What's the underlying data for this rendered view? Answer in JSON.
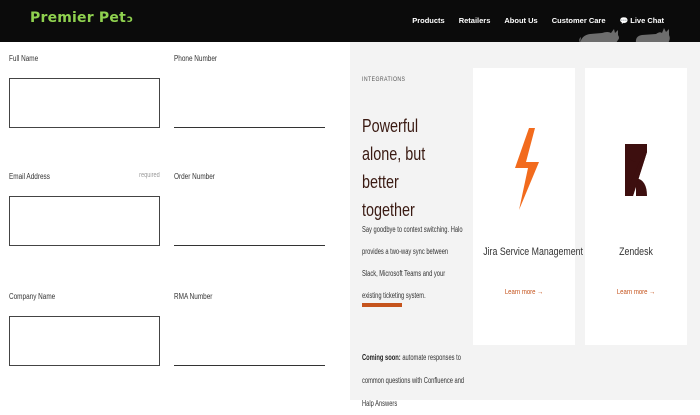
{
  "header": {
    "brand": "Premier Pet",
    "brand_mark": "⌠",
    "nav": [
      {
        "label": "Products"
      },
      {
        "label": "Retailers"
      },
      {
        "label": "About Us"
      },
      {
        "label": "Customer Care"
      },
      {
        "label": "Live Chat",
        "icon": "chat-bubbles-icon"
      }
    ]
  },
  "form": {
    "full_name_label": "Full Name",
    "phone_label": "Phone Number",
    "email_label": "Email Address",
    "email_required": "required",
    "order_label": "Order Number",
    "company_label": "Company Name",
    "rma_label": "RMA Number"
  },
  "integrations": {
    "kicker": "INTEGRATIONS",
    "headline": "Powerful alone, but better together",
    "description": "Say goodbye to context switching. Halo provides a two-way sync between Slack, Microsoft Teams and your existing ticketing system.",
    "coming_soon_label": "Coming soon:",
    "coming_soon_text": "automate responses to common questions with Confluence and Halp Answers",
    "cards": [
      {
        "name": "Jira Service Management",
        "link": "Learn more →",
        "icon": "lightning-bolt-icon"
      },
      {
        "name": "Zendesk",
        "link": "Learn more →",
        "icon": "zendesk-logo-icon"
      }
    ]
  },
  "colors": {
    "header_bg": "#0b0b0b",
    "brand_green": "#8fd14f",
    "accent_orange": "#c5531c",
    "headline_brown": "#3a1a12",
    "jira_orange": "#f26b1d",
    "zendesk_maroon": "#3d0f0f"
  }
}
